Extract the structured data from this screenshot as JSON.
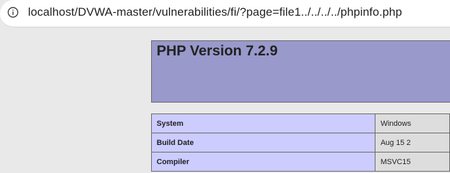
{
  "browser": {
    "address_bar": {
      "icon": "info-icon",
      "url": "localhost/DVWA-master/vulnerabilities/fi/?page=file1../../../../phpinfo.php"
    }
  },
  "phpinfo": {
    "title": "PHP Version 7.2.9",
    "rows": [
      {
        "label": "System",
        "value": "Windows"
      },
      {
        "label": "Build Date",
        "value": "Aug 15 2"
      },
      {
        "label": "Compiler",
        "value": "MSVC15"
      }
    ]
  },
  "colors": {
    "header_bg": "#9999cc",
    "label_bg": "#ccccff",
    "value_bg": "#dddddd",
    "page_bg": "#e9e9e9"
  }
}
